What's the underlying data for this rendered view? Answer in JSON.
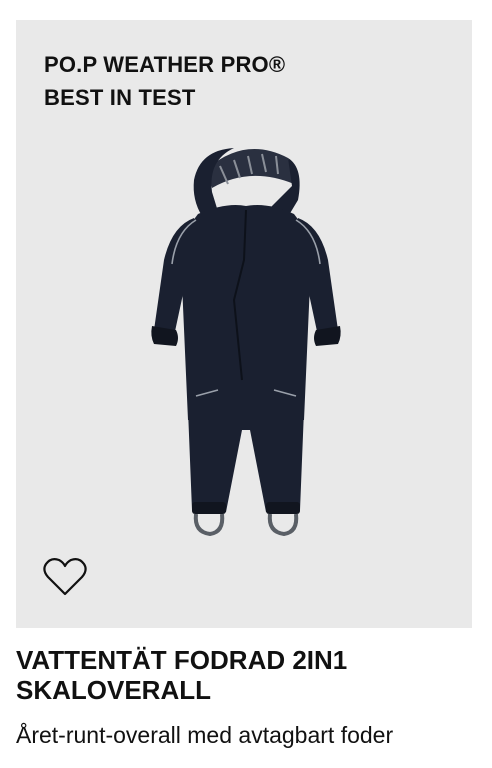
{
  "product": {
    "badge_lines": [
      "PO.P WEATHER PRO®",
      "BEST IN TEST"
    ],
    "title": "VATTENTÄT FODRAD 2IN1 SKALOVERALL",
    "subtitle": "Året-runt-overall med avtagbart foder",
    "image_icon": "snowsuit-image",
    "favorite_icon": "heart-outline-icon"
  },
  "colors": {
    "image_background": "#e9e9e9",
    "garment": "#1a2030",
    "text": "#111111"
  }
}
